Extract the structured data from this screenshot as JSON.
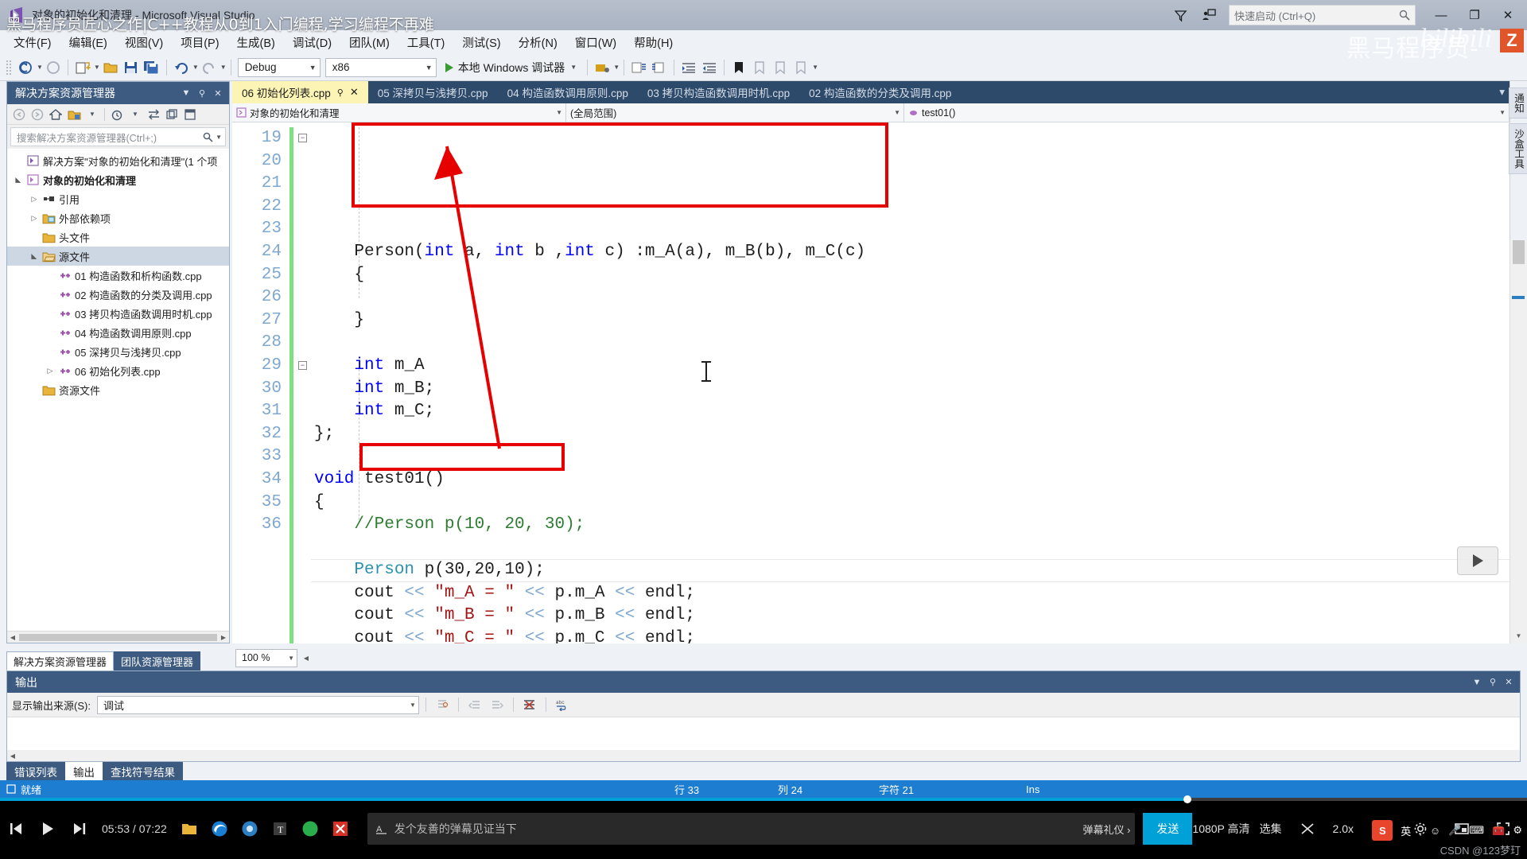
{
  "window": {
    "title": "对象的初始化和清理 - Microsoft Visual Studio",
    "quick_launch_placeholder": "快速启动 (Ctrl+Q)",
    "minimize": "—",
    "restore": "❐",
    "close": "✕",
    "help": "?",
    "feedback_icon": "feedback-icon",
    "filter_icon": "filter-icon"
  },
  "video_overlay": {
    "title": "黑马程序员匠心之作|C++教程从0到1入门编程,学习编程不再难",
    "watermark": "黑马程序员-",
    "watermark_bili": "bilibili",
    "watermark_badge": "Z",
    "csdn": "CSDN @123梦玎"
  },
  "menu": {
    "items": [
      "文件(F)",
      "编辑(E)",
      "视图(V)",
      "项目(P)",
      "生成(B)",
      "调试(D)",
      "团队(M)",
      "工具(T)",
      "测试(S)",
      "分析(N)",
      "窗口(W)",
      "帮助(H)"
    ]
  },
  "toolbar": {
    "config": "Debug",
    "platform": "x86",
    "run_label": "本地 Windows 调试器"
  },
  "solution_explorer": {
    "title": "解决方案资源管理器",
    "search_placeholder": "搜索解决方案资源管理器(Ctrl+;)",
    "tabs": [
      {
        "label": "解决方案资源管理器",
        "active": true
      },
      {
        "label": "团队资源管理器",
        "active": false
      }
    ],
    "tree": [
      {
        "label": "解决方案\"对象的初始化和清理\"(1 个项",
        "depth": 0,
        "twisty": "",
        "icon": "solution-icon",
        "bold": false,
        "selected": false
      },
      {
        "label": "对象的初始化和清理",
        "depth": 0,
        "twisty": "▲",
        "icon": "project-icon",
        "bold": true,
        "selected": false
      },
      {
        "label": "引用",
        "depth": 1,
        "twisty": "▷",
        "icon": "references-icon",
        "bold": false,
        "selected": false
      },
      {
        "label": "外部依赖项",
        "depth": 1,
        "twisty": "▷",
        "icon": "folder-ext-icon",
        "bold": false,
        "selected": false
      },
      {
        "label": "头文件",
        "depth": 1,
        "twisty": "",
        "icon": "folder-icon",
        "bold": false,
        "selected": false
      },
      {
        "label": "源文件",
        "depth": 1,
        "twisty": "▲",
        "icon": "folder-open-icon",
        "bold": false,
        "selected": true
      },
      {
        "label": "01 构造函数和析构函数.cpp",
        "depth": 2,
        "twisty": "",
        "icon": "cpp-file-icon",
        "bold": false,
        "selected": false
      },
      {
        "label": "02 构造函数的分类及调用.cpp",
        "depth": 2,
        "twisty": "",
        "icon": "cpp-file-icon",
        "bold": false,
        "selected": false
      },
      {
        "label": "03 拷贝构造函数调用时机.cpp",
        "depth": 2,
        "twisty": "",
        "icon": "cpp-file-icon",
        "bold": false,
        "selected": false
      },
      {
        "label": "04 构造函数调用原则.cpp",
        "depth": 2,
        "twisty": "",
        "icon": "cpp-file-icon",
        "bold": false,
        "selected": false
      },
      {
        "label": "05 深拷贝与浅拷贝.cpp",
        "depth": 2,
        "twisty": "",
        "icon": "cpp-file-icon",
        "bold": false,
        "selected": false
      },
      {
        "label": "06 初始化列表.cpp",
        "depth": 2,
        "twisty": "▷",
        "icon": "cpp-file-icon",
        "bold": false,
        "selected": false
      },
      {
        "label": "资源文件",
        "depth": 1,
        "twisty": "",
        "icon": "folder-icon",
        "bold": false,
        "selected": false
      }
    ]
  },
  "editor": {
    "tabs": [
      {
        "label": "06 初始化列表.cpp",
        "active": true
      },
      {
        "label": "05 深拷贝与浅拷贝.cpp",
        "active": false
      },
      {
        "label": "04 构造函数调用原则.cpp",
        "active": false
      },
      {
        "label": "03 拷贝构造函数调用时机.cpp",
        "active": false
      },
      {
        "label": "02 构造函数的分类及调用.cpp",
        "active": false
      }
    ],
    "nav": {
      "project": "对象的初始化和清理",
      "scope": "(全局范围)",
      "member": "test01()"
    },
    "zoom": "100 %",
    "first_line": 19,
    "lines": [
      {
        "n": 19,
        "text": "Person(int a, int b ,int c) :m_A(a), m_B(b), m_C(c)"
      },
      {
        "n": 20,
        "text": "{"
      },
      {
        "n": 21,
        "text": ""
      },
      {
        "n": 22,
        "text": "}"
      },
      {
        "n": 23,
        "text": ""
      },
      {
        "n": 24,
        "text": "int m_A"
      },
      {
        "n": 25,
        "text": "int m_B;"
      },
      {
        "n": 26,
        "text": "int m_C;"
      },
      {
        "n": 27,
        "text": "};"
      },
      {
        "n": 28,
        "text": ""
      },
      {
        "n": 29,
        "text": "void test01()"
      },
      {
        "n": 30,
        "text": "{"
      },
      {
        "n": 31,
        "text": "//Person p(10, 20, 30);"
      },
      {
        "n": 32,
        "text": ""
      },
      {
        "n": 33,
        "text": "Person p(30,20,10);"
      },
      {
        "n": 34,
        "text": "cout << \"m_A = \" << p.m_A << endl;"
      },
      {
        "n": 35,
        "text": "cout << \"m_B = \" << p.m_B << endl;"
      },
      {
        "n": 36,
        "text": "cout << \"m_C = \" << p.m_C << endl;"
      }
    ]
  },
  "right_docks": [
    "通知",
    "沙盒工具"
  ],
  "output": {
    "title": "输出",
    "source_label": "显示输出来源(S):",
    "source_value": "调试",
    "tabs": [
      {
        "label": "错误列表",
        "active": false
      },
      {
        "label": "输出",
        "active": true
      },
      {
        "label": "查找符号结果",
        "active": false
      }
    ]
  },
  "status_bar": {
    "ready": "就绪",
    "line": "行 33",
    "col": "列 24",
    "char": "字符 21",
    "ins": "Ins"
  },
  "player": {
    "time": "05:53 / 07:22",
    "danmaku_placeholder": "发个友善的弹幕见证当下",
    "gift_label": "弹幕礼仪 ›",
    "send_label": "发送",
    "quality": "1080P 高清",
    "episodes": "选集",
    "speed": "2.0x",
    "lang": "英",
    "progress_percent": 77.5,
    "accent": "#00a1d6"
  },
  "colors": {
    "vs_blue": "#3d5a80",
    "status_blue": "#1d7dd1",
    "active_tab": "#fcf4b4",
    "annotation_red": "#e60000",
    "changebar_green": "#7ee081"
  }
}
